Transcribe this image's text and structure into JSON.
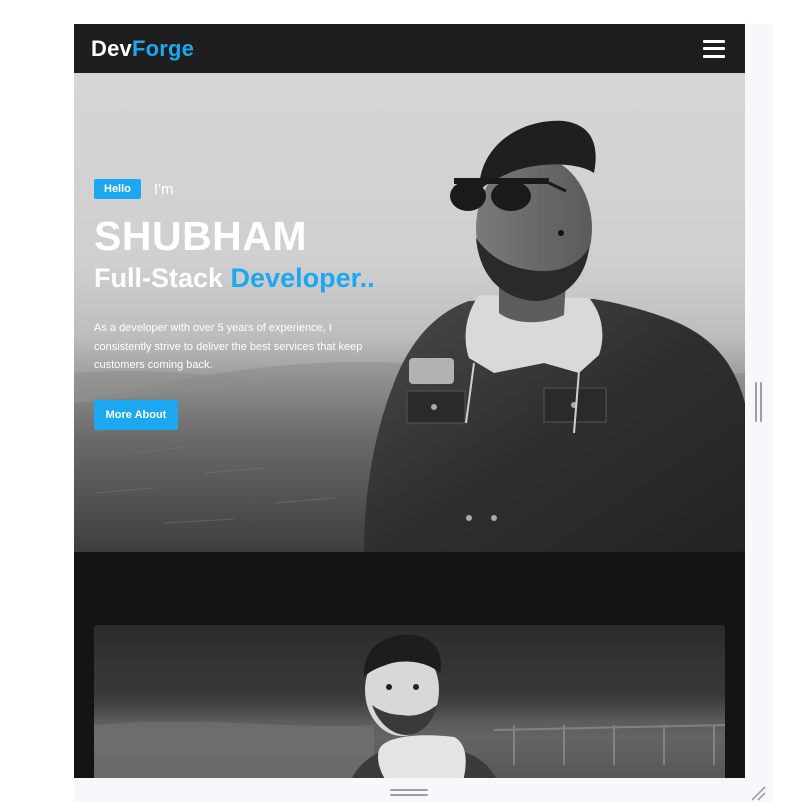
{
  "navbar": {
    "logo_part1": "Dev",
    "logo_part2": "Forge",
    "menu_icon": "hamburger-menu-icon"
  },
  "hero": {
    "badge": "Hello",
    "intro": "I'm",
    "name": "SHUBHAM",
    "role_part1": "Full-Stack",
    "role_part2": "Developer..",
    "description": "As a developer with over 5 years of experience, I consistently strive to deliver the best services that keep customers coming back.",
    "button_label": "More About"
  },
  "colors": {
    "accent": "#1ba8f0",
    "navbar_bg": "#1e1e1e",
    "section_bg": "#141414"
  }
}
